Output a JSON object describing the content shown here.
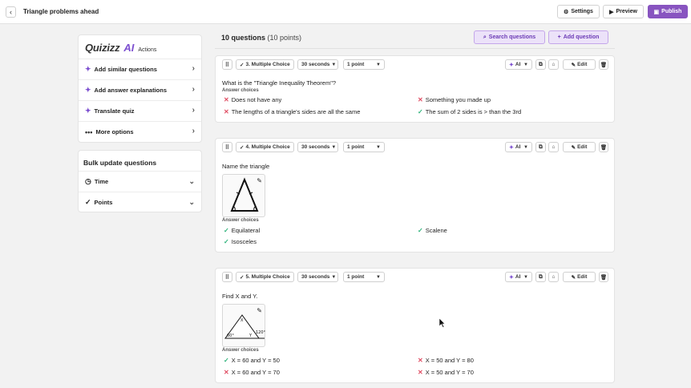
{
  "header": {
    "title": "Triangle problems ahead",
    "settings_label": "Settings",
    "preview_label": "Preview",
    "publish_label": "Publish"
  },
  "sidebar": {
    "brand": "Quizizz",
    "brand_ai": "AI",
    "actions_label": "Actions",
    "actions": [
      {
        "label": "Add similar questions"
      },
      {
        "label": "Add answer explanations"
      },
      {
        "label": "Translate quiz"
      },
      {
        "label": "More options"
      }
    ],
    "bulk": {
      "title": "Bulk update questions",
      "items": [
        {
          "label": "Time"
        },
        {
          "label": "Points"
        }
      ]
    }
  },
  "questions_header": {
    "count": "10 questions",
    "points": "(10 points)",
    "search_label": "Search questions",
    "add_label": "Add question"
  },
  "controls": {
    "ai_label": "AI",
    "edit_label": "Edit",
    "answer_choices_label": "Answer choices"
  },
  "questions": [
    {
      "type_label": "3. Multiple Choice",
      "time_label": "30 seconds",
      "points_label": "1 point",
      "text": "What is the \"Triangle Inequality Theorem\"?",
      "choices": [
        {
          "text": "Does not have any",
          "correct": false
        },
        {
          "text": "Something you made up",
          "correct": false
        },
        {
          "text": "The lengths of a triangle's sides are all the same",
          "correct": false
        },
        {
          "text": "The sum of 2 sides is > than the 3rd",
          "correct": true
        }
      ]
    },
    {
      "type_label": "4. Multiple Choice",
      "time_label": "30 seconds",
      "points_label": "1 point",
      "text": "Name the triangle",
      "choices": [
        {
          "text": "Equilateral",
          "correct": true
        },
        {
          "text": "Scalene",
          "correct": true
        },
        {
          "text": "Isosceles",
          "correct": true
        }
      ]
    },
    {
      "type_label": "5. Multiple Choice",
      "time_label": "30 seconds",
      "points_label": "1 point",
      "text": "Find X and Y.",
      "image_labels": [
        "X",
        "Y",
        "60°",
        "120°"
      ],
      "choices": [
        {
          "text": "X = 60 and Y = 50",
          "correct": true
        },
        {
          "text": "X = 50 and Y = 80",
          "correct": false
        },
        {
          "text": "X = 60 and Y = 70",
          "correct": false
        },
        {
          "text": "X = 50 and Y = 70",
          "correct": false
        }
      ]
    }
  ],
  "colors": {
    "accent": "#8854c0",
    "correct": "#2eb37a",
    "incorrect": "#e04e64"
  }
}
